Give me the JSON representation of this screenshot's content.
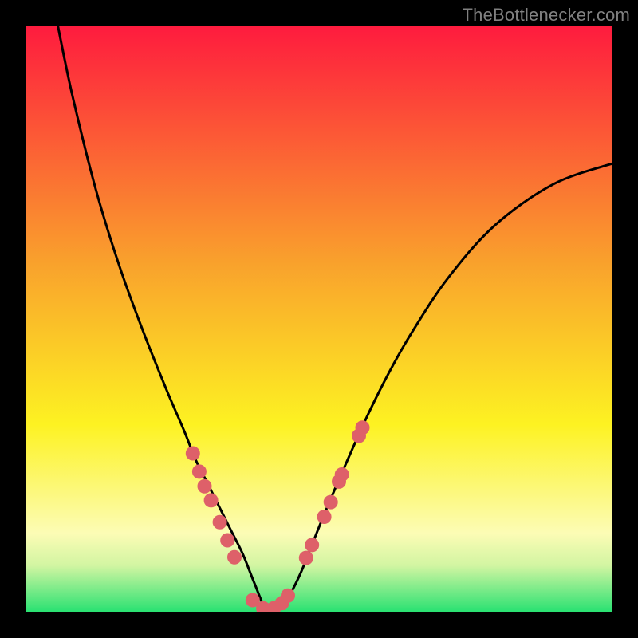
{
  "attribution": "TheBottlenecker.com",
  "colors": {
    "gradient_top": "#fe1b3e",
    "gradient_mid1": "#f9a32c",
    "gradient_mid2": "#fdf222",
    "gradient_mid3": "#fcfcb5",
    "gradient_mid4": "#d2f5a2",
    "gradient_bottom": "#27e171",
    "curve": "#000000",
    "marker_fill": "#de6069",
    "marker_stroke": "#de6069",
    "frame_background": "#000000"
  },
  "chart_data": {
    "type": "line",
    "title": "",
    "xlabel": "",
    "ylabel": "",
    "xlim": [
      0,
      100
    ],
    "ylim": [
      0,
      100
    ],
    "note": "Axes are normalized 0–100. Values estimated visually from the plot. The curve shows a V-shaped bottleneck dip reaching ~0 near x≈41, overlaid on a vertical heat gradient (red=bad at top, green=good at bottom).",
    "series": [
      {
        "name": "bottleneck-curve",
        "x": [
          5.5,
          8,
          12,
          16,
          20,
          24,
          27,
          29,
          31,
          33,
          35,
          37,
          39,
          41,
          43,
          45,
          47,
          49,
          51,
          54,
          58,
          62,
          66,
          72,
          80,
          90,
          100
        ],
        "y": [
          100,
          88,
          72,
          59,
          48,
          38,
          31,
          26,
          22,
          18,
          14,
          10,
          5,
          0.5,
          0.5,
          3,
          7,
          12,
          17,
          24,
          33,
          41,
          48,
          57,
          66,
          73,
          76.5
        ]
      }
    ],
    "markers": {
      "name": "highlighted-points",
      "x": [
        28.5,
        29.6,
        30.5,
        31.6,
        33.1,
        34.4,
        35.6,
        38.7,
        40.5,
        42.3,
        43.7,
        44.7,
        47.8,
        48.8,
        50.9,
        52.0,
        53.4,
        53.9,
        56.8,
        57.4
      ],
      "y": [
        27.1,
        24.0,
        21.5,
        19.1,
        15.4,
        12.3,
        9.4,
        2.1,
        0.7,
        0.7,
        1.6,
        2.9,
        9.3,
        11.5,
        16.3,
        18.8,
        22.3,
        23.5,
        30.1,
        31.5
      ]
    }
  }
}
